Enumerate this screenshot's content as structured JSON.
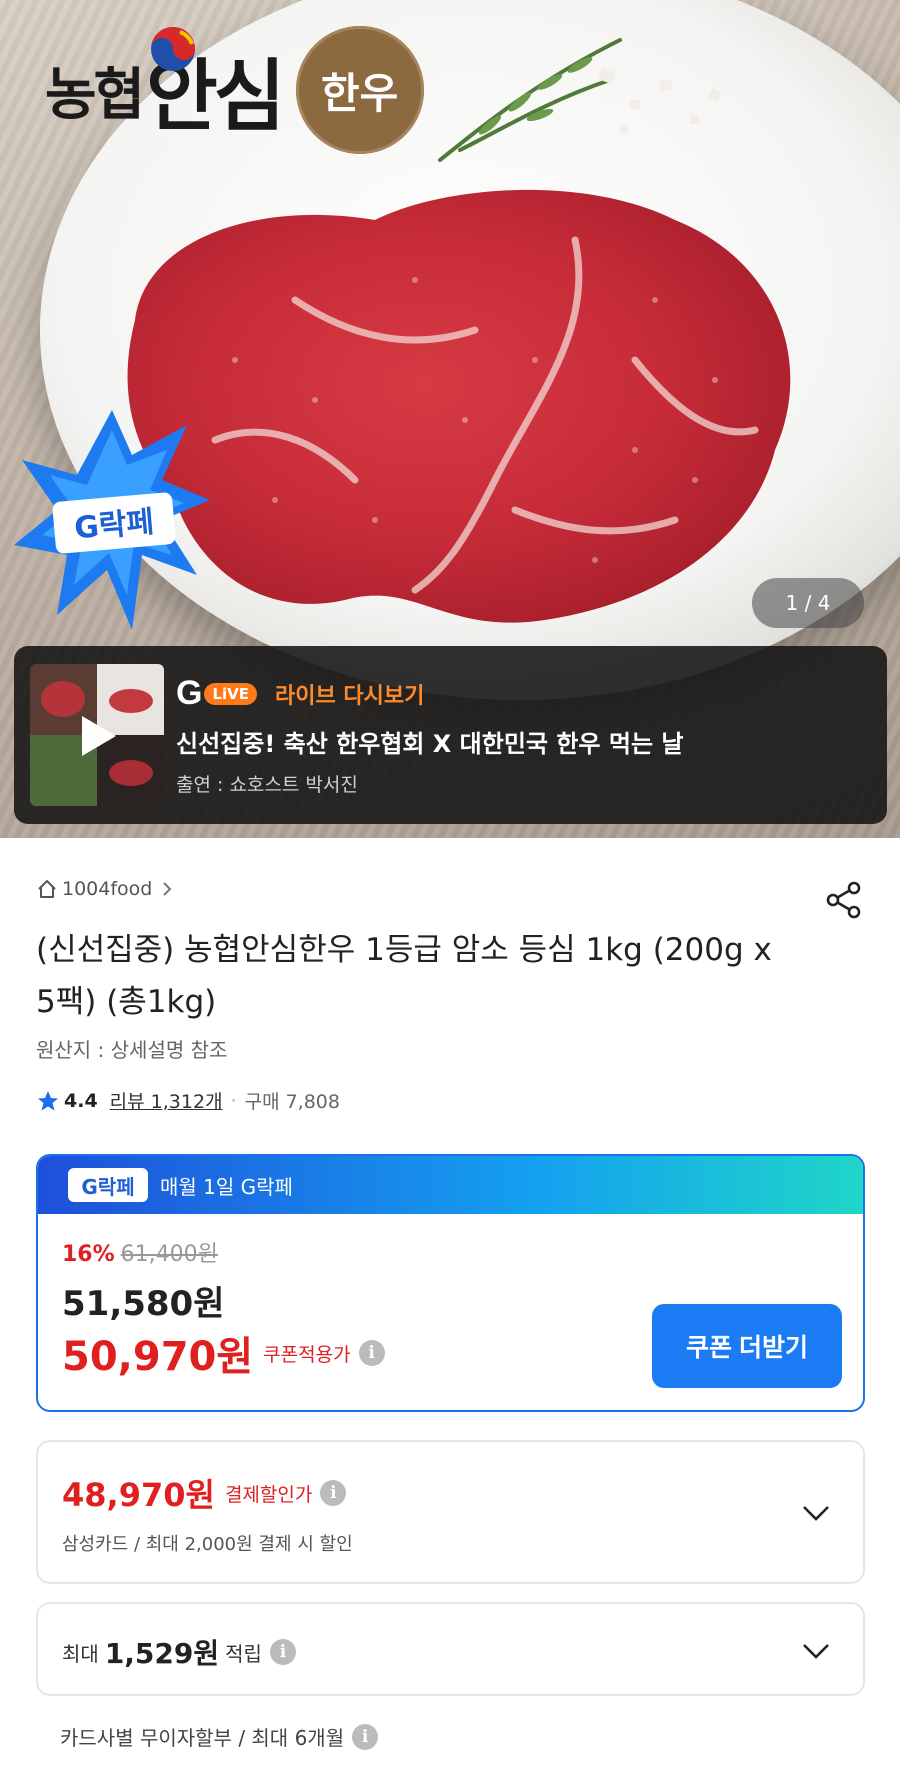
{
  "hero": {
    "brand_nh": "농협",
    "brand_an": "안심",
    "brand_badge": "한우",
    "glakpe_badge": "G락페",
    "counter": "1 / 4"
  },
  "live": {
    "g_letter": "G",
    "pill": "LiVE",
    "label": "라이브 다시보기",
    "title": "신선집중! 축산 한우협회 X 대한민국 한우 먹는 날",
    "host": "출연 : 쇼호스트 박서진"
  },
  "product": {
    "store": "1004food",
    "title": "(신선집중) 농협안심한우 1등급 암소 등심 1kg (200g x 5팩) (총1kg)",
    "origin": "원산지 : 상세설명 참조",
    "rating": "4.4",
    "review": "리뷰 1,312개",
    "dot": "·",
    "purchases": "구매 7,808"
  },
  "coupon": {
    "badge": "G락페",
    "head": "매월 1일 G락페",
    "discount_pct": "16%",
    "original_price": "61,400원",
    "price": "51,580원",
    "coupon_price": "50,970원",
    "coupon_label": "쿠폰적용가",
    "button": "쿠폰 더받기"
  },
  "payment": {
    "price": "48,970원",
    "label": "결제할인가",
    "sub": "삼성카드 / 최대 2,000원 결제 시 할인"
  },
  "points": {
    "prefix": "최대",
    "amount": "1,529원",
    "suffix": "적립"
  },
  "installment": {
    "text": "카드사별 무이자할부 / 최대 6개월"
  },
  "colors": {
    "accent_red": "#e02020",
    "accent_blue": "#1a7bf5",
    "live_orange": "#ff7a1a",
    "brand_brown": "#8b6a40"
  },
  "icons": {
    "info": "i"
  }
}
